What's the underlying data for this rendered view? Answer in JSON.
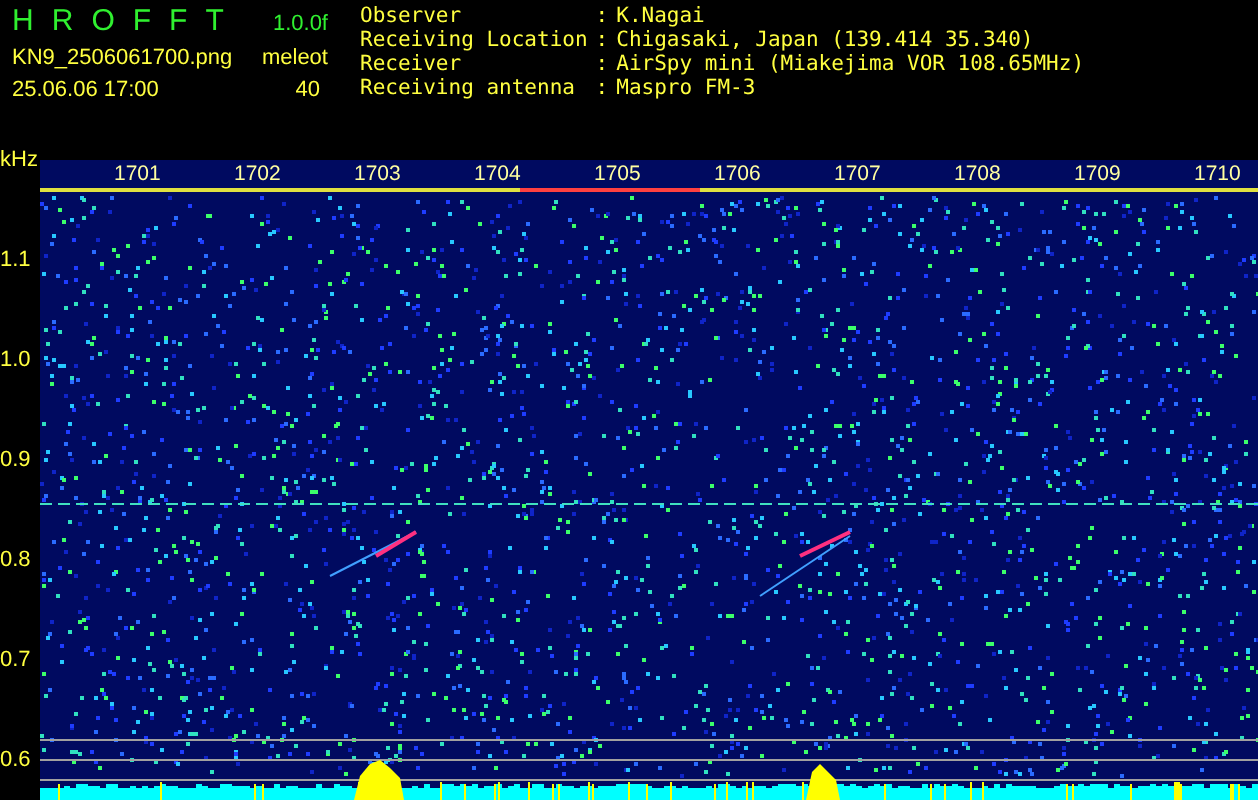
{
  "app": {
    "title_letters": [
      "H",
      "R",
      "O",
      "F",
      "F",
      "T"
    ],
    "version": "1.0.0f",
    "filename": "KN9_2506061700.png",
    "datetime": "25.06.06 17:00",
    "count_label": "meleot",
    "count": "40"
  },
  "info": [
    {
      "label": "Observer",
      "separator": ":",
      "value": "K.Nagai"
    },
    {
      "label": "Receiving Location",
      "separator": ":",
      "value": "Chigasaki, Japan (139.414 35.340)"
    },
    {
      "label": "Receiver",
      "separator": ":",
      "value": "AirSpy mini (Miakejima VOR 108.65MHz)"
    },
    {
      "label": "Receiving antenna",
      "separator": ":",
      "value": "Maspro FM-3"
    }
  ],
  "spectrogram": {
    "unit": "kHz",
    "y_labels": [
      "1.1",
      "1.0",
      "0.9",
      "0.8",
      "0.7",
      "0.6"
    ],
    "time_labels": [
      "1701",
      "1702",
      "1703",
      "1704",
      "1705",
      "1706",
      "1707",
      "1708",
      "1709",
      "1710"
    ]
  }
}
